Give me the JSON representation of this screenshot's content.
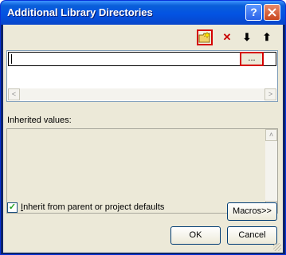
{
  "window": {
    "title": "Additional Library Directories",
    "help_icon": "?",
    "close_icon": "X"
  },
  "toolbar": {
    "new_icon": "folder-new-icon",
    "delete_glyph": "✕",
    "down_glyph": "⬇",
    "up_glyph": "⬆",
    "highlight_color": "#d40000"
  },
  "list": {
    "browse_label": "...",
    "scroll_left": "<",
    "scroll_right": ">"
  },
  "inherited": {
    "label": "Inherited values:",
    "scroll_up": "˄",
    "scroll_down": "˅"
  },
  "inherit_checkbox": {
    "checked": true,
    "label_prefix": "I",
    "label_rest": "nherit from parent or project defaults"
  },
  "buttons": {
    "macros": "Macros>>",
    "ok": "OK",
    "cancel": "Cancel"
  },
  "colors": {
    "titlebar": "#0353e3",
    "dialog_bg": "#ece9d8"
  }
}
